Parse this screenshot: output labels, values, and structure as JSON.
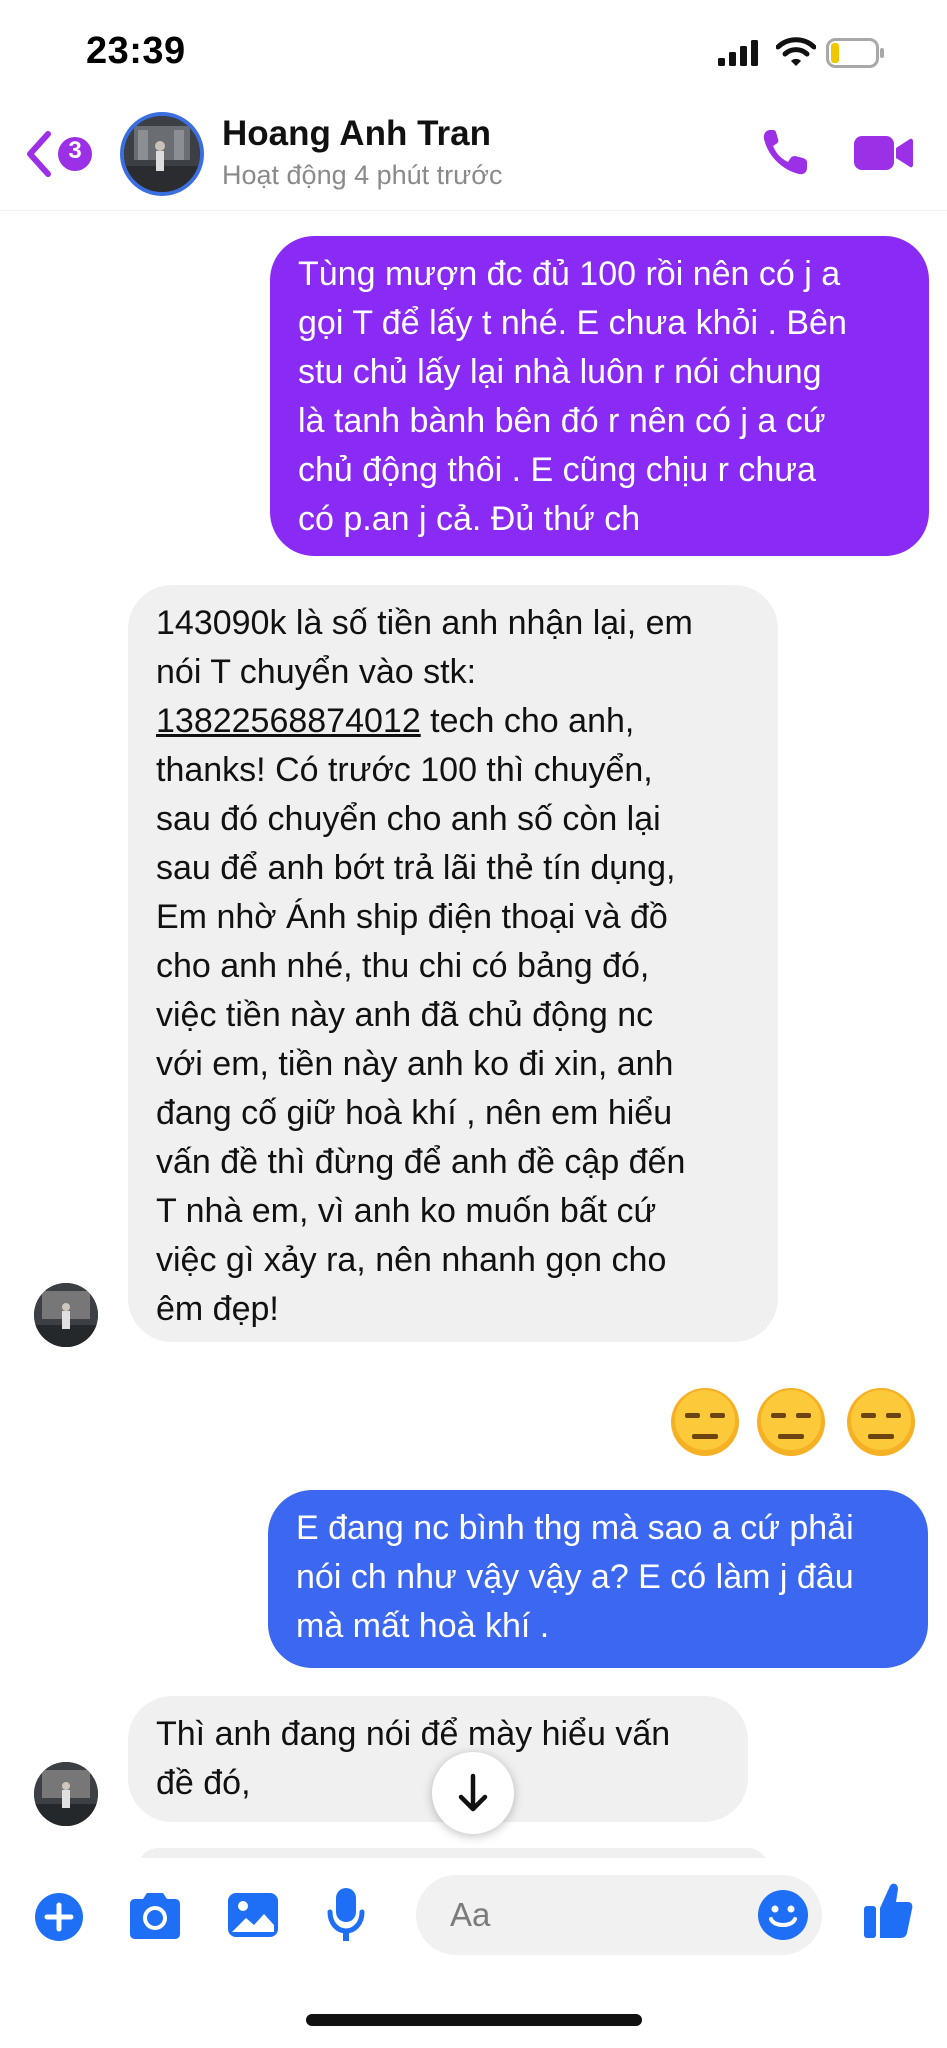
{
  "status_bar": {
    "time": "23:39"
  },
  "header": {
    "unread_count": "3",
    "contact_name": "Hoang Anh Tran",
    "contact_status": "Hoạt động 4 phút trước"
  },
  "messages": [
    {
      "direction": "outgoing",
      "text": "Tùng mượn đc đủ 100 rồi nên có j a\ngọi T để lấy t nhé. E chưa khỏi . Bên\nstu chủ lấy lại nhà luôn r nói chung\nlà tanh bành bên đó r nên có j a cứ\nchủ động thôi . E cũng chịu r chưa\ncó p.an j cả. Đủ thứ ch"
    },
    {
      "direction": "incoming",
      "text_before": "143090k là số tiền anh nhận lại, em\nnói T chuyển vào stk:\n",
      "account_number": "13822568874012",
      "text_after": " tech cho anh,\nthanks! Có trước 100 thì chuyển,\nsau đó chuyển cho anh số còn lại\nsau để anh bớt trả lãi thẻ tín dụng,\nEm nhờ Ánh ship điện thoại và đồ\ncho anh nhé, thu chi có bảng đó,\nviệc tiền này anh đã chủ động nc\nvới em, tiền này anh ko đi xin, anh\nđang cố giữ hoà khí , nên em hiểu\nvấn đề thì đừng để anh đề cập đến\nT nhà em, vì anh ko muốn bất cứ\nviệc gì xảy ra, nên nhanh gọn cho\nêm đẹp!"
    },
    {
      "direction": "outgoing",
      "text": "E đang nc bình thg mà sao a cứ phải\nnói ch như vậy vậy a? E có làm j đâu\nmà mất hoà khí ."
    },
    {
      "direction": "incoming",
      "text": "Thì anh đang nói để mày hiểu vấn\nđề đó,"
    }
  ],
  "reactions": [
    "expressionless-face",
    "expressionless-face",
    "expressionless-face"
  ],
  "composer": {
    "placeholder": "Aa"
  },
  "colors": {
    "accent_purple": "#8a2bf5",
    "accent_blue": "#3b67f1",
    "icon_blue": "#1e6ff5",
    "header_icons": "#9b30e6"
  }
}
